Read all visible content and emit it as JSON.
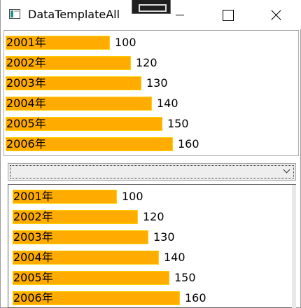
{
  "window": {
    "title": "DataTemplateAll"
  },
  "colors": {
    "bar_fill": "#ffab00",
    "bar_border": "#ffd000"
  },
  "icons": {
    "app": "app-window-icon",
    "dev_toolbar": "dev-toolbar-icon",
    "minimize": "minimize-icon",
    "maximize": "maximize-icon",
    "close": "close-icon",
    "dropdown": "chevron-down-icon"
  },
  "list": {
    "items": [
      {
        "year": "2001年",
        "value": 100
      },
      {
        "year": "2002年",
        "value": 120
      },
      {
        "year": "2003年",
        "value": 130
      },
      {
        "year": "2004年",
        "value": 140
      },
      {
        "year": "2005年",
        "value": 150
      },
      {
        "year": "2006年",
        "value": 160
      }
    ]
  },
  "combo": {
    "selected": "",
    "items": [
      {
        "year": "2001年",
        "value": 100
      },
      {
        "year": "2002年",
        "value": 120
      },
      {
        "year": "2003年",
        "value": 130
      },
      {
        "year": "2004年",
        "value": 140
      },
      {
        "year": "2005年",
        "value": 150
      },
      {
        "year": "2006年",
        "value": 160
      }
    ]
  }
}
